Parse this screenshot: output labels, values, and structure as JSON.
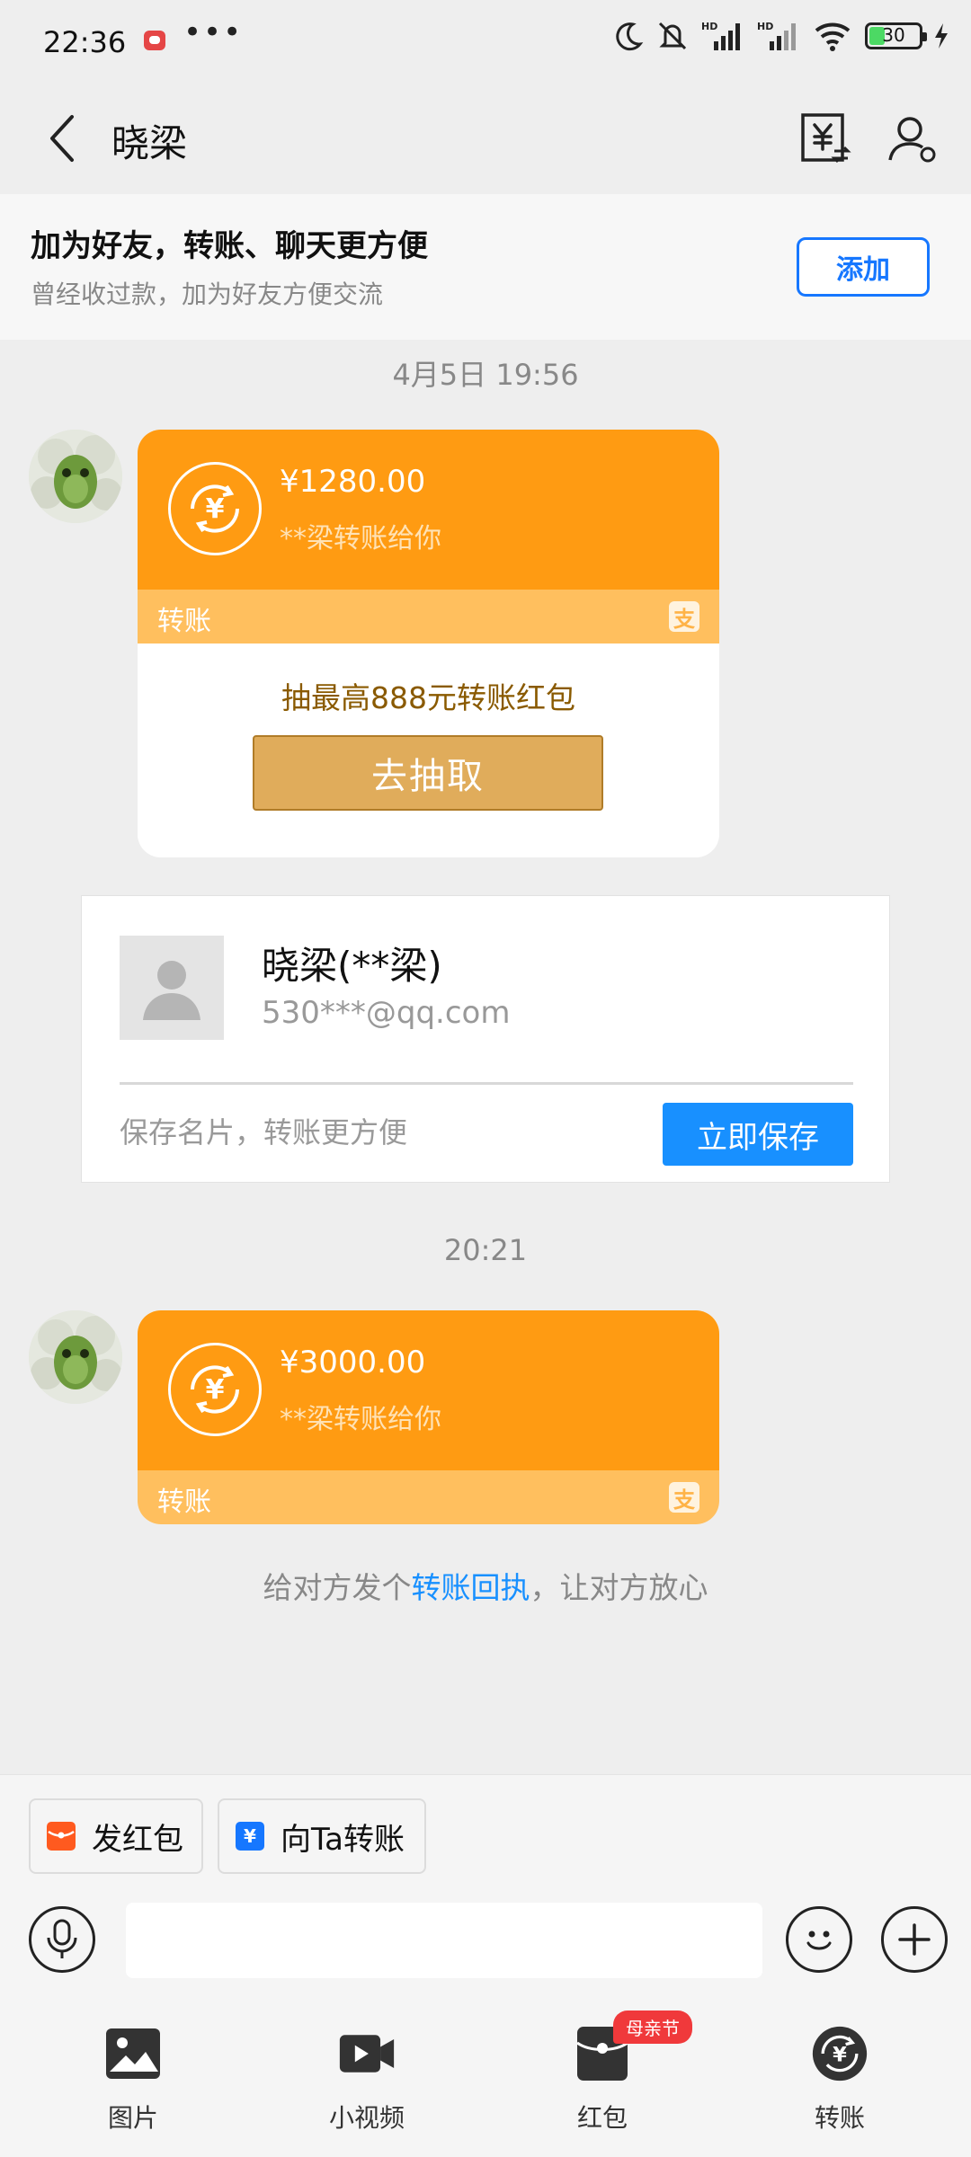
{
  "status_bar": {
    "time": "22:36",
    "dots": "•••",
    "battery_level": "30"
  },
  "header": {
    "title": "晓梁",
    "icons": [
      "back-arrow-icon",
      "bill-icon",
      "contact-settings-icon"
    ]
  },
  "friend_banner": {
    "title": "加为好友，转账、聊天更方便",
    "subtitle": "曾经收过款，加为好友方便交流",
    "add_label": "添加"
  },
  "messages": {
    "time1": "4月5日 19:56",
    "transfer1": {
      "amount": "¥1280.00",
      "desc": "**梁转账给你",
      "label": "转账",
      "promo_text": "抽最高888元转账红包",
      "promo_button": "去抽取"
    },
    "contact_card": {
      "name": "晓梁(**梁)",
      "email": "530***@qq.com",
      "hint": "保存名片，转账更方便",
      "save_label": "立即保存"
    },
    "time2": "20:21",
    "transfer2": {
      "amount": "¥3000.00",
      "desc": "**梁转账给你",
      "label": "转账"
    },
    "receipt": {
      "prefix": "给对方发个",
      "link": "转账回执",
      "suffix": "，让对方放心"
    }
  },
  "quick_actions": [
    {
      "label": "发红包",
      "icon": "red-packet-icon",
      "color": "#ff5a1f"
    },
    {
      "label": "向Ta转账",
      "icon": "transfer-icon",
      "color": "#1677ff"
    }
  ],
  "composer": {
    "placeholder": ""
  },
  "toolbar": {
    "items": [
      {
        "label": "图片",
        "icon": "image-icon"
      },
      {
        "label": "小视频",
        "icon": "video-icon"
      },
      {
        "label": "红包",
        "icon": "red-packet-icon",
        "badge": "母亲节"
      },
      {
        "label": "转账",
        "icon": "transfer-icon"
      }
    ]
  },
  "colors": {
    "accent": "#1890ff",
    "transfer_orange": "#ff9b12",
    "transfer_strip": "#ffbf5e",
    "badge_red": "#f0393b"
  }
}
